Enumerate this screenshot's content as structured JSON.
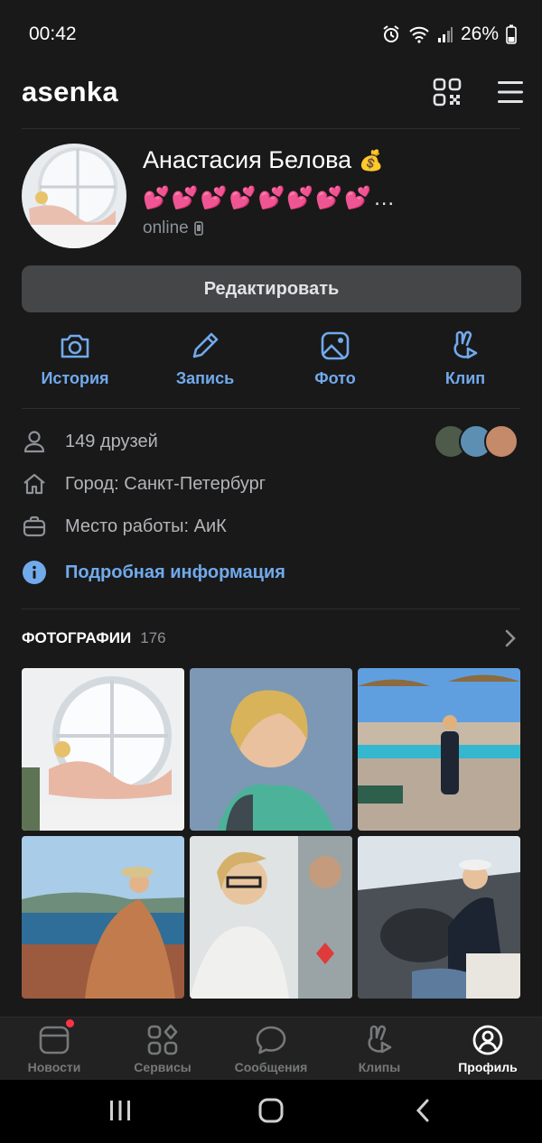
{
  "status_bar": {
    "time": "00:42",
    "battery": "26%"
  },
  "header": {
    "title": "asenka",
    "qr_icon": "qr-code-icon",
    "menu_icon": "hamburger-menu-icon"
  },
  "profile": {
    "name": "Анастасия Белова",
    "name_badge": "💰",
    "status": "💕💕💕💕💕💕💕💕…",
    "online": "online",
    "edit_button": "Редактировать"
  },
  "actions": [
    {
      "label": "История",
      "icon": "camera-icon"
    },
    {
      "label": "Запись",
      "icon": "pencil-icon"
    },
    {
      "label": "Фото",
      "icon": "image-icon"
    },
    {
      "label": "Клип",
      "icon": "clip-icon"
    }
  ],
  "info": {
    "friends": "149 друзей",
    "city": "Город: Санкт-Петербург",
    "work": "Место работы: АиК",
    "more": "Подробная информация"
  },
  "photos": {
    "title": "ФОТОГРАФИИ",
    "count": "176"
  },
  "tabs": [
    {
      "label": "Новости",
      "icon": "news-icon"
    },
    {
      "label": "Сервисы",
      "icon": "services-icon"
    },
    {
      "label": "Сообщения",
      "icon": "messages-icon"
    },
    {
      "label": "Клипы",
      "icon": "clips-icon"
    },
    {
      "label": "Профиль",
      "icon": "profile-icon",
      "active": true
    }
  ],
  "colors": {
    "accent": "#71aaeb",
    "background": "#19191a",
    "notification": "#ff3347"
  }
}
